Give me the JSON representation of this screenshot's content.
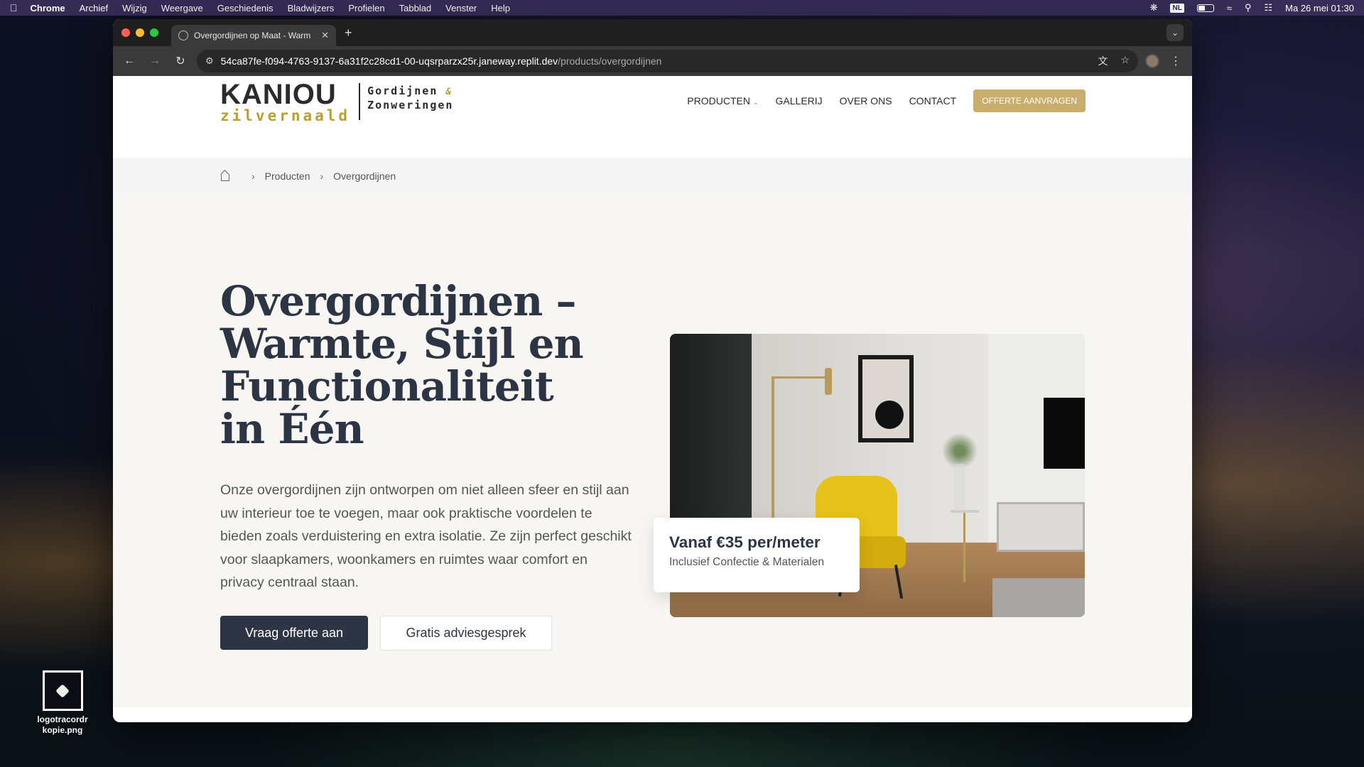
{
  "menubar": {
    "app_name": "Chrome",
    "items": [
      "Archief",
      "Wijzig",
      "Weergave",
      "Geschiedenis",
      "Bladwijzers",
      "Profielen",
      "Tabblad",
      "Venster",
      "Help"
    ],
    "input_source": "NL",
    "datetime": "Ma 26 mei  01:30"
  },
  "browser": {
    "tab_title": "Overgordijnen op Maat - Warm",
    "url_host": "54ca87fe-f094-4763-9137-6a31f2c28cd1-00-uqsrparzx25r.janeway.replit.dev",
    "url_path": "/products/overgordijnen"
  },
  "site": {
    "logo": {
      "brand": "KANIOU",
      "sub": "zilvernaald",
      "tagline_1": "Gordijnen",
      "amp": "&",
      "tagline_2": "Zonweringen"
    },
    "nav": {
      "products": "PRODUCTEN",
      "gallery": "GALLERIJ",
      "about": "OVER ONS",
      "contact": "CONTACT",
      "cta": "OFFERTE AANVRAGEN"
    },
    "breadcrumb": {
      "level1": "Producten",
      "level2": "Overgordijnen"
    },
    "hero": {
      "title": "Overgordijnen – Warmte, Stijl en Functionaliteit in Één",
      "text": "Onze overgordijnen zijn ontworpen om niet alleen sfeer en stijl aan uw interieur toe te voegen, maar ook praktische voordelen te bieden zoals verduistering en extra isolatie. Ze zijn perfect geschikt voor slaapkamers, woonkamers en ruimtes waar comfort en privacy centraal staan.",
      "btn_primary": "Vraag offerte aan",
      "btn_secondary": "Gratis adviesgesprek",
      "price": "Vanaf €35 per/meter",
      "price_sub": "Inclusief Confectie & Materialen"
    }
  },
  "desktop": {
    "file_label_1": "logotracordr",
    "file_label_2": "kopie.png"
  },
  "colors": {
    "accent_gold": "#c9ad6c",
    "navy": "#2d3545",
    "logo_gold": "#b8a030"
  }
}
